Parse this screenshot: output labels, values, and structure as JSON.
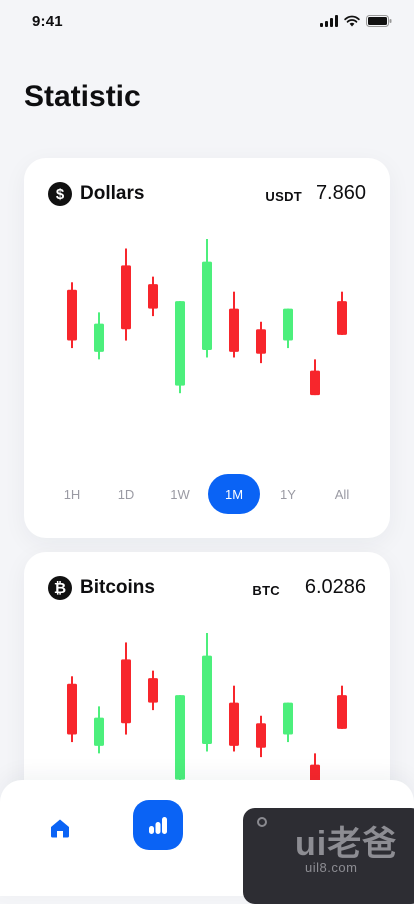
{
  "status_bar": {
    "time": "9:41"
  },
  "page": {
    "title": "Statistic"
  },
  "cards": [
    {
      "coin": "Dollars",
      "symbol": "$",
      "unit": "USDT",
      "value": "7.860",
      "periods": [
        "1H",
        "1D",
        "1W",
        "1M",
        "1Y",
        "All"
      ],
      "active_period": "1M"
    },
    {
      "coin": "Bitcoins",
      "symbol": "₿",
      "unit": "BTC",
      "value": "6.0286"
    }
  ],
  "colors": {
    "up": "#4cef7c",
    "down": "#f7262c",
    "accent": "#0a63f5"
  },
  "chart_data": [
    {
      "type": "candlestick",
      "series_note": "relative price level, 0 = bottom, 100 = top of chart area",
      "candles": [
        {
          "open": 65,
          "close": 38,
          "high": 69,
          "low": 34
        },
        {
          "open": 32,
          "close": 47,
          "high": 53,
          "low": 28
        },
        {
          "open": 78,
          "close": 44,
          "high": 87,
          "low": 38
        },
        {
          "open": 68,
          "close": 55,
          "high": 72,
          "low": 51
        },
        {
          "open": 14,
          "close": 59,
          "high": 59,
          "low": 10
        },
        {
          "open": 33,
          "close": 80,
          "high": 92,
          "low": 29
        },
        {
          "open": 55,
          "close": 32,
          "high": 64,
          "low": 29
        },
        {
          "open": 44,
          "close": 31,
          "high": 48,
          "low": 26
        },
        {
          "open": 38,
          "close": 55,
          "high": 55,
          "low": 34
        },
        {
          "open": 22,
          "close": 9,
          "high": 28,
          "low": 9
        },
        {
          "open": 59,
          "close": 41,
          "high": 64,
          "low": 41
        }
      ]
    },
    {
      "type": "candlestick",
      "candles": [
        {
          "open": 65,
          "close": 38,
          "high": 69,
          "low": 34
        },
        {
          "open": 32,
          "close": 47,
          "high": 53,
          "low": 28
        },
        {
          "open": 78,
          "close": 44,
          "high": 87,
          "low": 38
        },
        {
          "open": 68,
          "close": 55,
          "high": 72,
          "low": 51
        },
        {
          "open": 14,
          "close": 59,
          "high": 59,
          "low": 10
        },
        {
          "open": 33,
          "close": 80,
          "high": 92,
          "low": 29
        },
        {
          "open": 55,
          "close": 32,
          "high": 64,
          "low": 29
        },
        {
          "open": 44,
          "close": 31,
          "high": 48,
          "low": 26
        },
        {
          "open": 38,
          "close": 55,
          "high": 55,
          "low": 34
        },
        {
          "open": 22,
          "close": 9,
          "high": 28,
          "low": 9
        },
        {
          "open": 59,
          "close": 41,
          "high": 64,
          "low": 41
        }
      ]
    }
  ],
  "watermark": {
    "main": "ui老爸",
    "sub": "uil8.com"
  }
}
